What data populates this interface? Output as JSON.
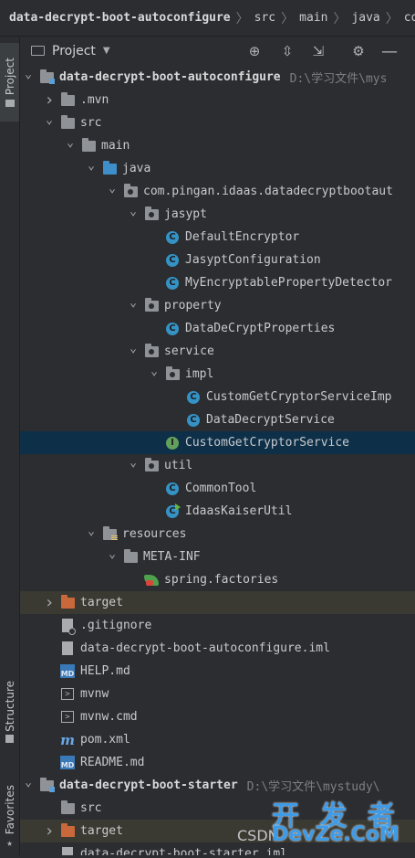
{
  "breadcrumb": [
    "data-decrypt-boot-autoconfigure",
    "src",
    "main",
    "java",
    "com"
  ],
  "left_strip": {
    "project_tab": "Project",
    "structure_tab": "Structure",
    "favorites_tab": "Favorites"
  },
  "panel": {
    "title": "Project"
  },
  "tree": [
    {
      "indent": 0,
      "arrow": "down",
      "icon": "folder-module",
      "label": "data-decrypt-boot-autoconfigure",
      "bold": true,
      "path": "D:\\学习文件\\mys"
    },
    {
      "indent": 1,
      "arrow": "right",
      "icon": "folder",
      "label": ".mvn"
    },
    {
      "indent": 1,
      "arrow": "down",
      "icon": "folder",
      "label": "src"
    },
    {
      "indent": 2,
      "arrow": "down",
      "icon": "folder",
      "label": "main"
    },
    {
      "indent": 3,
      "arrow": "down",
      "icon": "folder-blue",
      "label": "java"
    },
    {
      "indent": 4,
      "arrow": "down",
      "icon": "package",
      "label": "com.pingan.idaas.datadecryptbootaut"
    },
    {
      "indent": 5,
      "arrow": "down",
      "icon": "package",
      "label": "jasypt"
    },
    {
      "indent": 6,
      "arrow": "",
      "icon": "class",
      "label": "DefaultEncryptor"
    },
    {
      "indent": 6,
      "arrow": "",
      "icon": "class",
      "label": "JasyptConfiguration"
    },
    {
      "indent": 6,
      "arrow": "",
      "icon": "class",
      "label": "MyEncryptablePropertyDetector"
    },
    {
      "indent": 5,
      "arrow": "down",
      "icon": "package",
      "label": "property"
    },
    {
      "indent": 6,
      "arrow": "",
      "icon": "class",
      "label": "DataDeCryptProperties"
    },
    {
      "indent": 5,
      "arrow": "down",
      "icon": "package",
      "label": "service"
    },
    {
      "indent": 6,
      "arrow": "down",
      "icon": "package",
      "label": "impl"
    },
    {
      "indent": 7,
      "arrow": "",
      "icon": "class",
      "label": "CustomGetCryptorServiceImp"
    },
    {
      "indent": 7,
      "arrow": "",
      "icon": "class",
      "label": "DataDecryptService"
    },
    {
      "indent": 6,
      "arrow": "",
      "icon": "interface",
      "label": "CustomGetCryptorService",
      "selected": true
    },
    {
      "indent": 5,
      "arrow": "down",
      "icon": "package",
      "label": "util"
    },
    {
      "indent": 6,
      "arrow": "",
      "icon": "class",
      "label": "CommonTool"
    },
    {
      "indent": 6,
      "arrow": "",
      "icon": "class-run",
      "label": "IdaasKaiserUtil"
    },
    {
      "indent": 3,
      "arrow": "down",
      "icon": "folder-res",
      "label": "resources"
    },
    {
      "indent": 4,
      "arrow": "down",
      "icon": "folder",
      "label": "META-INF"
    },
    {
      "indent": 5,
      "arrow": "",
      "icon": "spring",
      "label": "spring.factories"
    },
    {
      "indent": 1,
      "arrow": "right",
      "icon": "folder-orange",
      "label": "target",
      "highlight": true
    },
    {
      "indent": 1,
      "arrow": "",
      "icon": "file-ignore",
      "label": ".gitignore"
    },
    {
      "indent": 1,
      "arrow": "",
      "icon": "file",
      "label": "data-decrypt-boot-autoconfigure.iml"
    },
    {
      "indent": 1,
      "arrow": "",
      "icon": "md",
      "label": "HELP.md"
    },
    {
      "indent": 1,
      "arrow": "",
      "icon": "terminal",
      "label": "mvnw"
    },
    {
      "indent": 1,
      "arrow": "",
      "icon": "terminal",
      "label": "mvnw.cmd"
    },
    {
      "indent": 1,
      "arrow": "",
      "icon": "maven",
      "label": "pom.xml"
    },
    {
      "indent": 1,
      "arrow": "",
      "icon": "md",
      "label": "README.md"
    },
    {
      "indent": 0,
      "arrow": "down",
      "icon": "folder-module",
      "label": "data-decrypt-boot-starter",
      "bold": true,
      "path": "D:\\学习文件\\mystudy\\"
    },
    {
      "indent": 1,
      "arrow": "",
      "icon": "folder",
      "label": "src"
    },
    {
      "indent": 1,
      "arrow": "right",
      "icon": "folder-orange",
      "label": "target",
      "highlight": true
    },
    {
      "indent": 1,
      "arrow": "",
      "icon": "file",
      "label": "data-decrypt-boot-starter.iml"
    }
  ],
  "watermark": {
    "csdn": "CSDN",
    "devze_cn": "开 发 者",
    "devze_en": "DevZe.CoM"
  }
}
